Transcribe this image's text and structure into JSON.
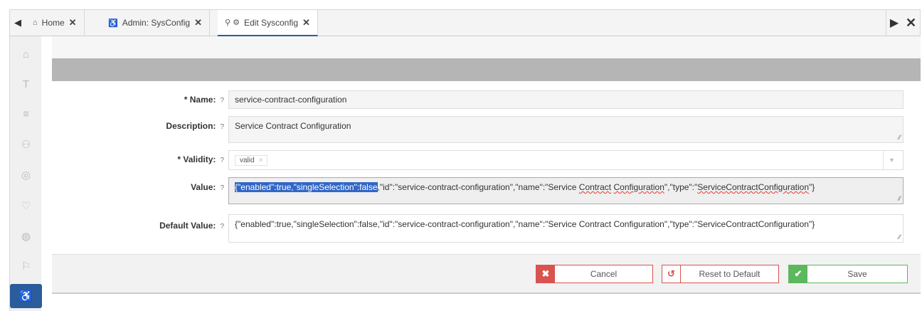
{
  "tabs": {
    "nav_left_icon": "caret-left-icon",
    "items": [
      {
        "icon": "home-icon",
        "icon_glyph": "⌂",
        "label": "Home",
        "close": "✕"
      },
      {
        "icon": "admin-icon",
        "icon_glyph": "♿",
        "label": "Admin: SysConfig",
        "close": "✕"
      },
      {
        "icon": "pin-gear-icon",
        "icon_glyph": "⚲ ⚙",
        "label": "Edit Sysconfig",
        "close": "✕"
      }
    ],
    "right_arrow": "▶",
    "right_close": "✕"
  },
  "sidebar": {
    "items": [
      {
        "name": "home",
        "glyph": "⌂"
      },
      {
        "name": "text",
        "glyph": "T"
      },
      {
        "name": "database",
        "glyph": "≡"
      },
      {
        "name": "users",
        "glyph": "⚇"
      },
      {
        "name": "eye",
        "glyph": "◎"
      },
      {
        "name": "bulb",
        "glyph": "♡"
      },
      {
        "name": "globe",
        "glyph": "◍"
      },
      {
        "name": "megaphone",
        "glyph": "⚐"
      },
      {
        "name": "admin",
        "glyph": "♿"
      }
    ]
  },
  "form": {
    "name_label": "* Name:",
    "name_value": "service-contract-configuration",
    "description_label": "Description:",
    "description_value": "Service Contract Configuration",
    "validity_label": "* Validity:",
    "validity_tag": "valid",
    "validity_tag_remove": "×",
    "validity_caret": "▼",
    "value_label": "Value:",
    "value_selected": "{\"enabled\":true,\"singleSelection\":false",
    "value_part1": ",\"id\":\"service-contract-configuration\",\"name\":\"Service ",
    "value_word_contract": "Contract",
    "value_space": " ",
    "value_word_configuration": "Configuration",
    "value_part2": "\",\"type\":\"",
    "value_word_type": "ServiceContractConfiguration",
    "value_part3": "\"}",
    "default_value_label": "Default Value:",
    "default_value": "{\"enabled\":true,\"singleSelection\":false,\"id\":\"service-contract-configuration\",\"name\":\"Service Contract Configuration\",\"type\":\"ServiceContractConfiguration\"}",
    "help_glyph": "?"
  },
  "buttons": {
    "cancel": {
      "icon_glyph": "✖",
      "label": "Cancel"
    },
    "reset": {
      "icon_glyph": "↺",
      "label": "Reset to Default"
    },
    "save": {
      "icon_glyph": "✔",
      "label": "Save"
    }
  },
  "colors": {
    "accent": "#2b5c9c",
    "danger": "#d9534f",
    "success": "#5cb85c",
    "selection": "#3166c7"
  }
}
